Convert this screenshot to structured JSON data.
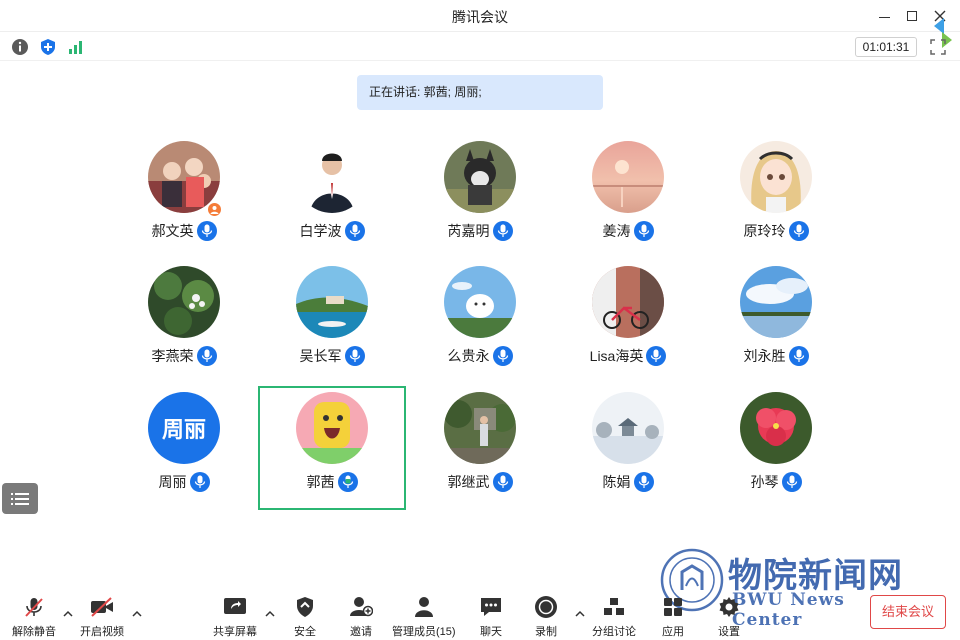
{
  "window": {
    "title": "腾讯会议"
  },
  "status": {
    "timer": "01:01:31"
  },
  "speaking_banner": {
    "label": "正在讲话: 郭茜; 周丽;"
  },
  "participants": [
    {
      "name": "郝文英",
      "mic": "on",
      "host": true
    },
    {
      "name": "白学波",
      "mic": "on"
    },
    {
      "name": "芮嘉明",
      "mic": "on"
    },
    {
      "name": "姜涛",
      "mic": "on"
    },
    {
      "name": "原玲玲",
      "mic": "on"
    },
    {
      "name": "李燕荣",
      "mic": "on"
    },
    {
      "name": "吴长军",
      "mic": "on"
    },
    {
      "name": "么贵永",
      "mic": "on"
    },
    {
      "name": "Lisa海英",
      "mic": "on"
    },
    {
      "name": "刘永胜",
      "mic": "on"
    },
    {
      "name": "周丽",
      "mic": "on",
      "avatar_text": "周丽"
    },
    {
      "name": "郭茜",
      "mic": "speaking",
      "active": true
    },
    {
      "name": "郭继武",
      "mic": "on"
    },
    {
      "name": "陈娟",
      "mic": "on"
    },
    {
      "name": "孙琴",
      "mic": "on"
    }
  ],
  "toolbar": {
    "unmute": "解除静音",
    "start_video": "开启视频",
    "share_screen": "共享屏幕",
    "security": "安全",
    "invite": "邀请",
    "manage_members": "管理成员(15)",
    "chat": "聊天",
    "record": "录制",
    "breakout": "分组讨论",
    "apps": "应用",
    "settings": "设置",
    "end_meeting": "结束会议"
  },
  "watermark": {
    "cn": "物院新闻网",
    "en": "BWU News Center"
  },
  "colors": {
    "accent": "#1a73e8",
    "active_border": "#2bb673",
    "banner_bg": "#d9e8fd",
    "end_red": "#e04848",
    "host_badge": "#f57c38"
  }
}
